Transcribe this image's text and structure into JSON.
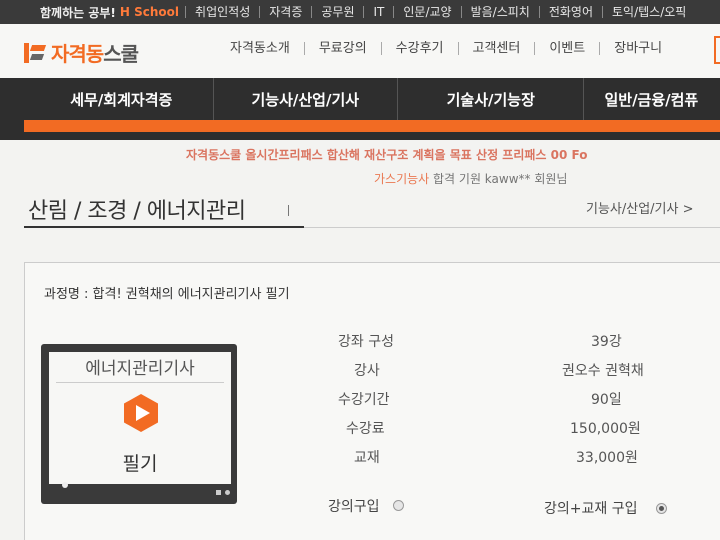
{
  "topbar": {
    "promo": "함께하는 공부!",
    "brand": "H School",
    "links": [
      "취업인적성",
      "자격증",
      "공무원",
      "IT",
      "인문/교양",
      "발음/스피치",
      "전화영어",
      "토익/텝스/오픽"
    ]
  },
  "header": {
    "logo_orange": "자격동",
    "logo_grey": "스쿨",
    "nav": [
      "자격동소개",
      "무료강의",
      "수강후기",
      "고객센터",
      "이벤트",
      "장바구니"
    ]
  },
  "categories": [
    "세무/회계자격증",
    "기능사/산업/기사",
    "기술사/기능장",
    "일반/금융/컴퓨"
  ],
  "ticker": {
    "line1": "자격동스쿨 올시간프리패스 합산해 재산구조 계획을 목표 산정 프리패스 00 Fo",
    "line2_highlight": "가스기능사",
    "line2_rest": " 합격 기원 kaww** 회원님"
  },
  "page": {
    "title": "산림 / 조경 / 에너지관리",
    "breadcrumb": "기능사/산업/기사 >"
  },
  "course": {
    "name": "과정명 : 합격! 권혁채의 에너지관리기사 필기",
    "thumb_title": "에너지관리기사",
    "thumb_sub": "필기",
    "info": [
      {
        "label": "강좌 구성",
        "value": "39강"
      },
      {
        "label": "강사",
        "value": "권오수 권혁채"
      },
      {
        "label": "수강기간",
        "value": "90일"
      },
      {
        "label": "수강료",
        "value": "150,000원"
      },
      {
        "label": "교재",
        "value": "33,000원"
      }
    ],
    "options": [
      {
        "label": "강의구입",
        "selected": false
      },
      {
        "label": "강의+교재 구입",
        "selected": true
      }
    ]
  },
  "colors": {
    "accent": "#f26b23",
    "dark": "#2e2e2e"
  }
}
